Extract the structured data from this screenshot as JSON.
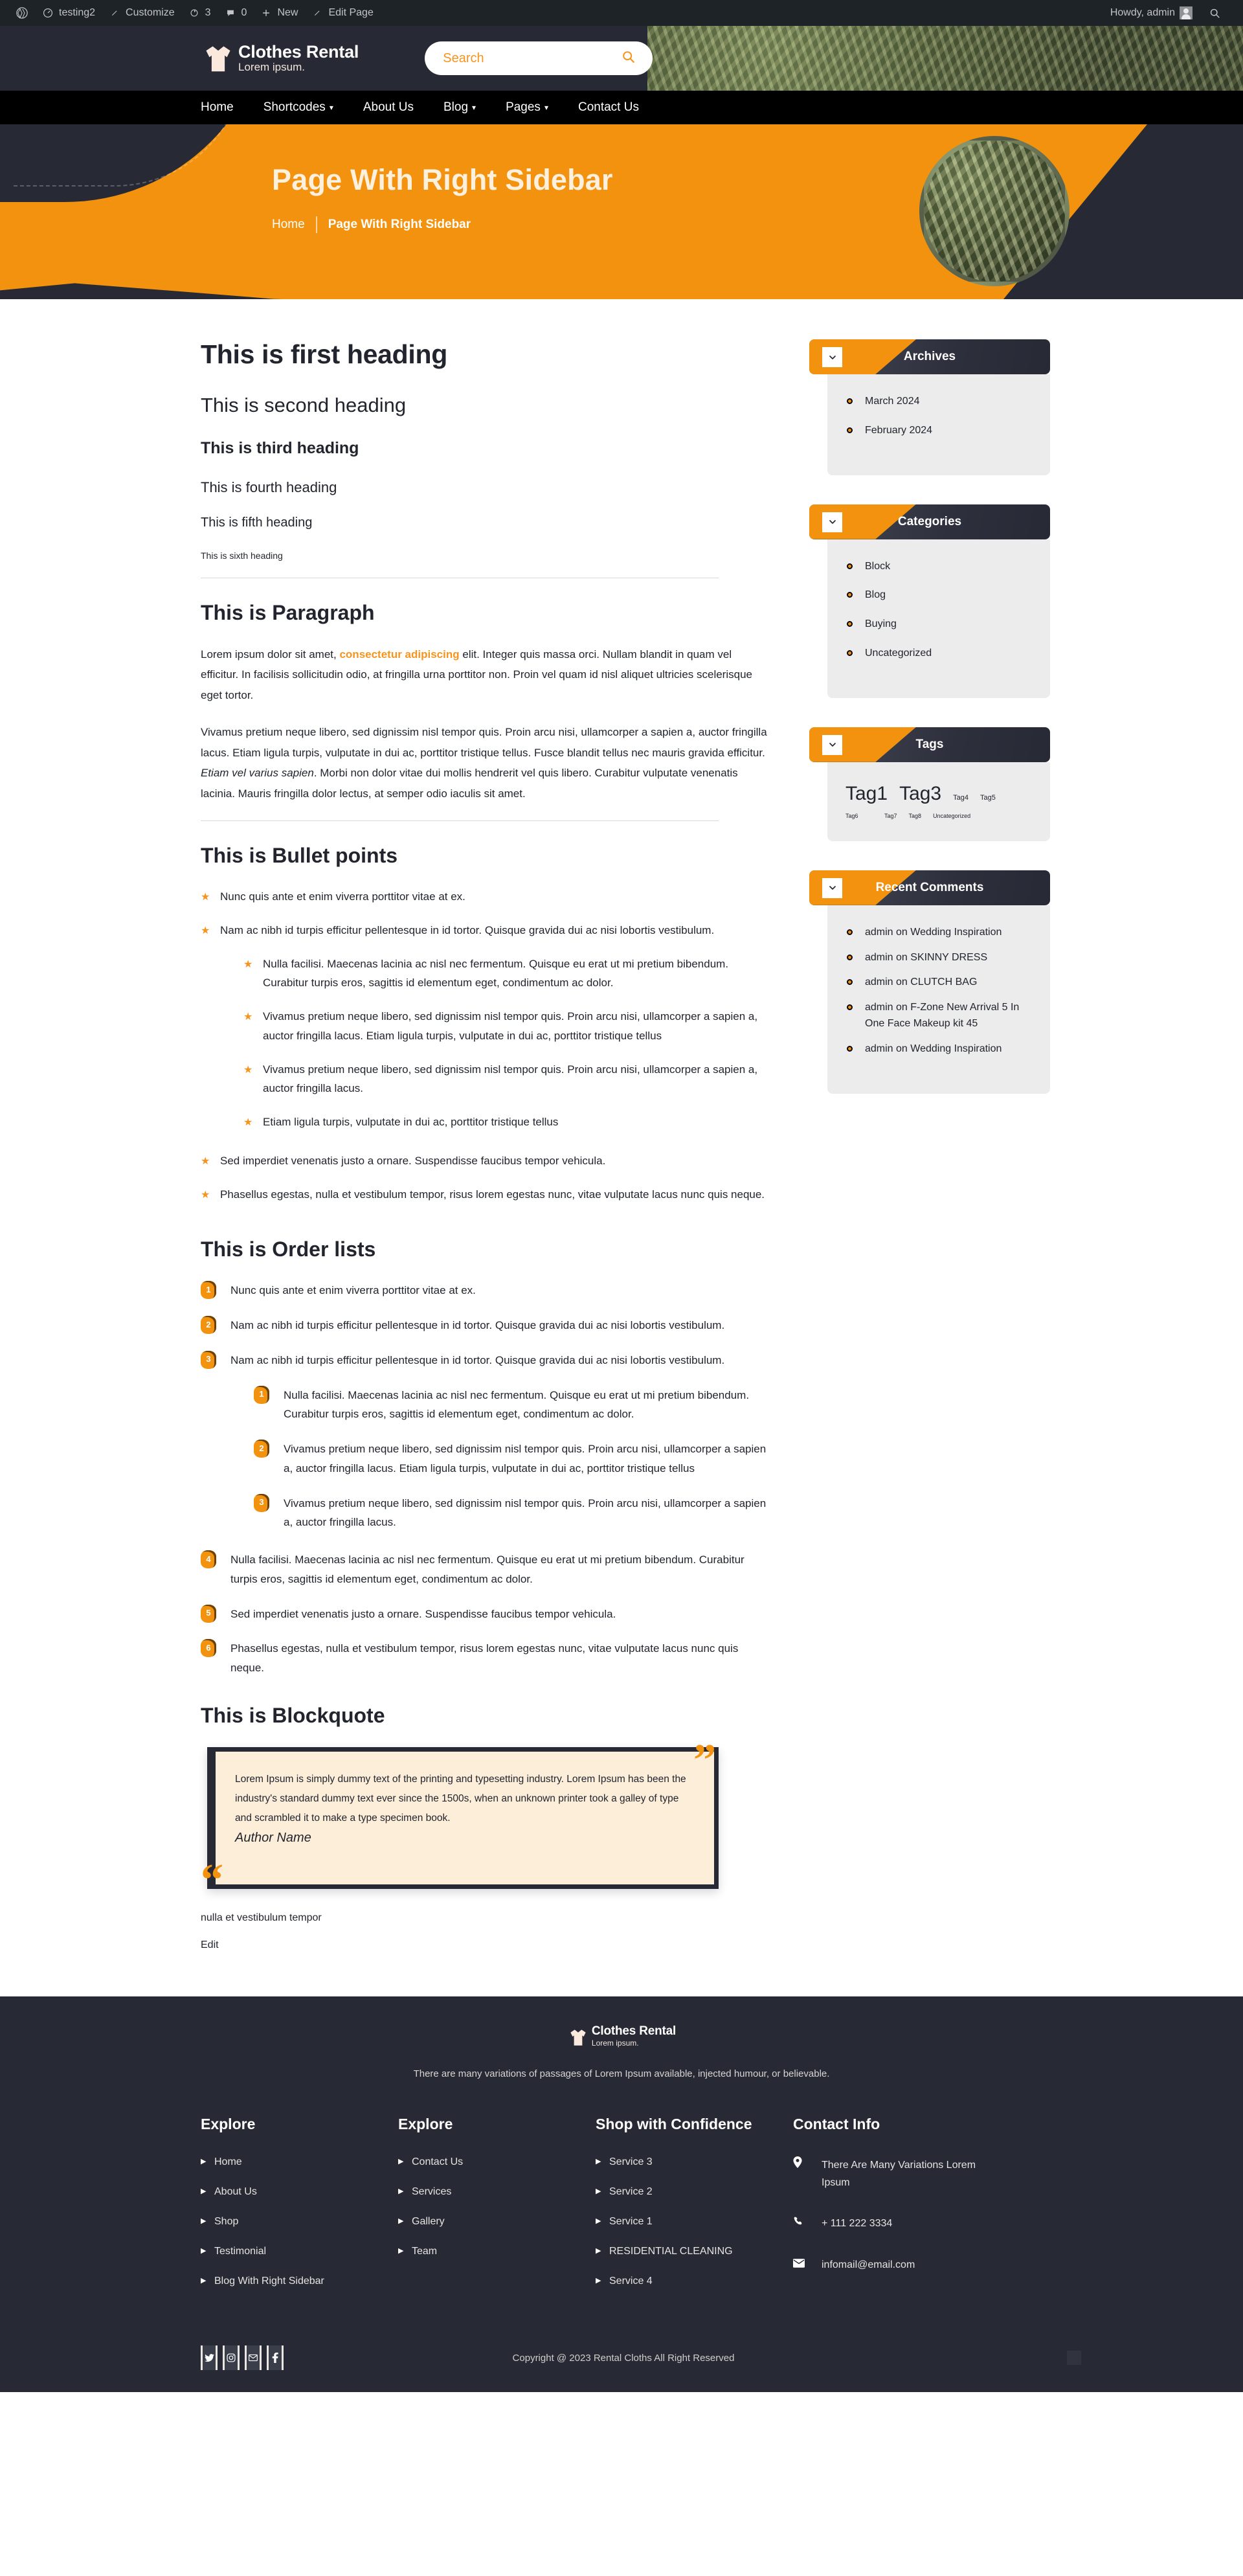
{
  "adminbar": {
    "wp_icon": "wordpress-icon",
    "site_name": "testing2",
    "customize": "Customize",
    "updates_count": "3",
    "comments_count": "0",
    "new": "New",
    "edit_page": "Edit Page",
    "howdy": "Howdy, admin"
  },
  "header": {
    "brand_name": "Clothes Rental",
    "brand_sub": "Lorem ipsum.",
    "search_placeholder": "Search",
    "search_value": ""
  },
  "nav": {
    "items": [
      {
        "label": "Home",
        "has_caret": false
      },
      {
        "label": "Shortcodes",
        "has_caret": true
      },
      {
        "label": "About Us",
        "has_caret": false
      },
      {
        "label": "Blog",
        "has_caret": true
      },
      {
        "label": "Pages",
        "has_caret": true
      },
      {
        "label": "Contact Us",
        "has_caret": false
      }
    ]
  },
  "hero": {
    "title": "Page With Right Sidebar",
    "crumb_home": "Home",
    "crumb_current": "Page With Right Sidebar"
  },
  "main": {
    "headings": [
      "This is first heading",
      "This is second heading",
      "This is third heading",
      "This is fourth heading",
      "This is fifth heading",
      "This is sixth heading"
    ],
    "paragraph_title": "This is Paragraph",
    "para1_a": "Lorem ipsum dolor sit amet, ",
    "para1_hl": "consectetur adipiscing",
    "para1_b": " elit. Integer quis massa orci. Nullam blandit in quam vel efficitur. In facilisis sollicitudin odio, at fringilla urna porttitor non. Proin vel quam id nisl aliquet ultricies scelerisque eget tortor.",
    "para2_a": "Vivamus pretium neque libero, sed dignissim nisl tempor quis. Proin arcu nisi, ullamcorper a sapien a, auctor fringilla lacus. Etiam ligula turpis, vulputate in dui ac, porttitor tristique tellus. Fusce blandit tellus nec mauris gravida efficitur. ",
    "para2_it": "Etiam vel varius sapien",
    "para2_b": ". Morbi non dolor vitae dui mollis hendrerit vel quis libero. Curabitur vulputate venenatis lacinia. Mauris fringilla dolor lectus, at semper odio iaculis sit amet.",
    "bullets_title": "This is Bullet points",
    "bullets": {
      "item1": "Nunc quis ante et enim viverra porttitor vitae at ex.",
      "item2": "Nam ac nibh id turpis efficitur pellentesque in id tortor. Quisque gravida dui ac nisi lobortis vestibulum.",
      "sub1": "Nulla facilisi. Maecenas lacinia ac nisl nec fermentum. Quisque eu erat ut mi pretium bibendum. Curabitur turpis eros, sagittis id elementum eget, condimentum ac dolor.",
      "sub2": "Vivamus pretium neque libero, sed dignissim nisl tempor quis. Proin arcu nisi, ullamcorper a sapien a, auctor fringilla lacus. Etiam ligula turpis, vulputate in dui ac, porttitor tristique tellus",
      "sub3": "Vivamus pretium neque libero, sed dignissim nisl tempor quis. Proin arcu nisi, ullamcorper a sapien a, auctor fringilla lacus.",
      "sub4": "Etiam ligula turpis, vulputate in dui ac, porttitor tristique tellus",
      "item3": "Sed imperdiet venenatis justo a ornare. Suspendisse faucibus tempor vehicula.",
      "item4": "Phasellus egestas, nulla et vestibulum tempor, risus lorem egestas nunc, vitae vulputate lacus nunc quis neque."
    },
    "orders_title": "This is Order lists",
    "orders": {
      "item1": "Nunc quis ante et enim viverra porttitor vitae at ex.",
      "item2": "Nam ac nibh id turpis efficitur pellentesque in id tortor. Quisque gravida dui ac nisi lobortis vestibulum.",
      "item3": "Nam ac nibh id turpis efficitur pellentesque in id tortor. Quisque gravida dui ac nisi lobortis vestibulum.",
      "sub1": "Nulla facilisi. Maecenas lacinia ac nisl nec fermentum. Quisque eu erat ut mi pretium bibendum. Curabitur turpis eros, sagittis id elementum eget, condimentum ac dolor.",
      "sub2": "Vivamus pretium neque libero, sed dignissim nisl tempor quis. Proin arcu nisi, ullamcorper a sapien a, auctor fringilla lacus. Etiam ligula turpis, vulputate in dui ac, porttitor tristique tellus",
      "sub3": "Vivamus pretium neque libero, sed dignissim nisl tempor quis. Proin arcu nisi, ullamcorper a sapien a, auctor fringilla lacus.",
      "item4": "Nulla facilisi. Maecenas lacinia ac nisl nec fermentum. Quisque eu erat ut mi pretium bibendum. Curabitur turpis eros, sagittis id elementum eget, condimentum ac dolor.",
      "item5": "Sed imperdiet venenatis justo a ornare. Suspendisse faucibus tempor vehicula.",
      "item6": "Phasellus egestas, nulla et vestibulum tempor, risus lorem egestas nunc, vitae vulputate lacus nunc quis neque.",
      "numbers": [
        "1",
        "2",
        "3",
        "4",
        "5",
        "6"
      ],
      "sub_numbers": [
        "1",
        "2",
        "3"
      ]
    },
    "blockquote_title": "This is Blockquote",
    "blockquote_text": "Lorem Ipsum is simply dummy text of the printing and typesetting industry. Lorem Ipsum has been the industry's standard dummy text ever since the 1500s, when an unknown printer took a galley of type and scrambled it to make a type specimen book.",
    "blockquote_author": "Author Name",
    "post_note": "nulla et vestibulum tempor",
    "edit_link": "Edit"
  },
  "sidebar": {
    "archives": {
      "title": "Archives",
      "items": [
        "March 2024",
        "February 2024"
      ]
    },
    "categories": {
      "title": "Categories",
      "items": [
        "Block",
        "Blog",
        "Buying",
        "Uncategorized"
      ]
    },
    "tags": {
      "title": "Tags",
      "items": [
        {
          "label": "Tag1",
          "size": "xl"
        },
        {
          "label": "Tag3",
          "size": "xl"
        },
        {
          "label": "Tag4",
          "size": "sm"
        },
        {
          "label": "Tag5",
          "size": "sm"
        },
        {
          "label": "Tag6",
          "size": "xs"
        },
        {
          "label": "Tag7",
          "size": "xs"
        },
        {
          "label": "Tag8",
          "size": "xs"
        },
        {
          "label": "Uncategorized",
          "size": "xs"
        }
      ]
    },
    "recent_comments": {
      "title": "Recent Comments",
      "items": [
        "admin on Wedding Inspiration",
        "admin on SKINNY DRESS",
        "admin on CLUTCH BAG",
        "admin on F-Zone New Arrival 5 In One Face Makeup kit 45",
        "admin on Wedding Inspiration"
      ]
    }
  },
  "footer": {
    "brand_name": "Clothes Rental",
    "brand_sub": "Lorem ipsum.",
    "tagline": "There are many variations of passages of Lorem Ipsum available, injected humour, or believable.",
    "col1": {
      "title": "Explore",
      "items": [
        "Home",
        "About Us",
        "Shop",
        "Testimonial",
        "Blog With Right Sidebar"
      ]
    },
    "col2": {
      "title": "Explore",
      "items": [
        "Contact Us",
        "Services",
        "Gallery",
        "Team"
      ]
    },
    "col3": {
      "title": "Shop with Confidence",
      "items": [
        "Service 3",
        "Service 2",
        "Service 1",
        "RESIDENTIAL CLEANING",
        "Service 4"
      ]
    },
    "col4": {
      "title": "Contact Info",
      "address": "There Are Many Variations Lorem Ipsum",
      "phone": "+ 111 222 3334",
      "email": "infomail@email.com"
    },
    "socials": [
      "twitter-icon",
      "instagram-icon",
      "mail-icon",
      "facebook-icon"
    ],
    "copyright": "Copyright @ 2023 Rental Cloths All Right Reserved"
  },
  "colors": {
    "accent": "#f2920e",
    "dark": "#272a35",
    "cream": "#fdeed9",
    "light_gray": "#ececec"
  }
}
